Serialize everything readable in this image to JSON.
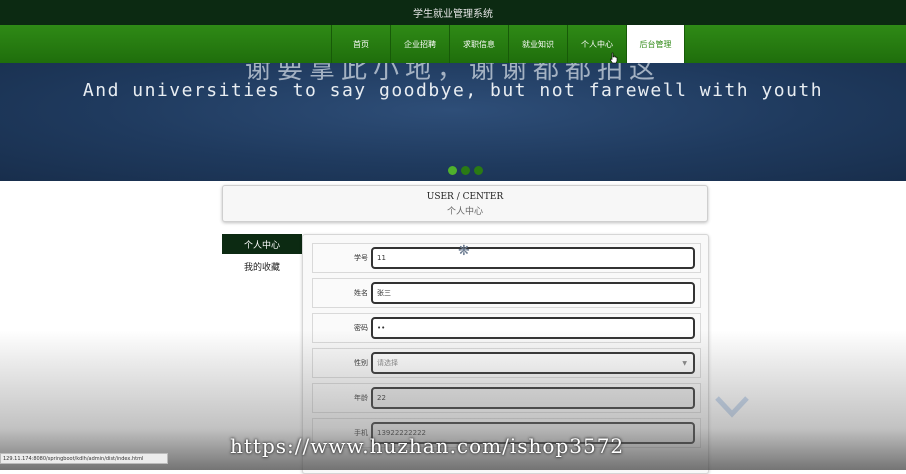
{
  "app": {
    "title": "学生就业管理系统"
  },
  "nav": {
    "items": [
      {
        "label": "首页"
      },
      {
        "label": "企业招聘"
      },
      {
        "label": "求职信息"
      },
      {
        "label": "就业知识"
      },
      {
        "label": "个人中心"
      },
      {
        "label": "后台管理",
        "active": true
      }
    ]
  },
  "banner": {
    "headline_partial": "谢要拿此小地，谢谢都都拍这",
    "subtitle": "And universities to say goodbye, but not farewell with youth",
    "dots": [
      {
        "active": true
      },
      {
        "active": false
      },
      {
        "active": false
      }
    ]
  },
  "center": {
    "title_en": "USER / CENTER",
    "title_zh": "个人中心"
  },
  "sidebar": {
    "items": [
      {
        "label": "个人中心",
        "active": true
      },
      {
        "label": "我的收藏",
        "active": false
      }
    ]
  },
  "form": {
    "fields": [
      {
        "label": "学号",
        "value": "11"
      },
      {
        "label": "姓名",
        "value": "张三"
      },
      {
        "label": "密码",
        "value": "••"
      },
      {
        "label": "性别",
        "value": "请选择"
      },
      {
        "label": "年龄",
        "value": "22"
      },
      {
        "label": "手机",
        "value": "13922222222"
      }
    ]
  },
  "statusbar": {
    "url": "129.11.174:8080/springboot/kdlh/admin/dist/index.html"
  },
  "watermark": {
    "text": "https://www.huzhan.com/ishop3572"
  },
  "colors": {
    "dark_green": "#0c2a12",
    "nav_green": "#2f8a16",
    "banner_blue": "#1f3a5e"
  },
  "icons": {
    "cursor": "hand-pointer-icon",
    "spinner": "loading-spinner-icon",
    "select": "chevron-down-icon"
  }
}
